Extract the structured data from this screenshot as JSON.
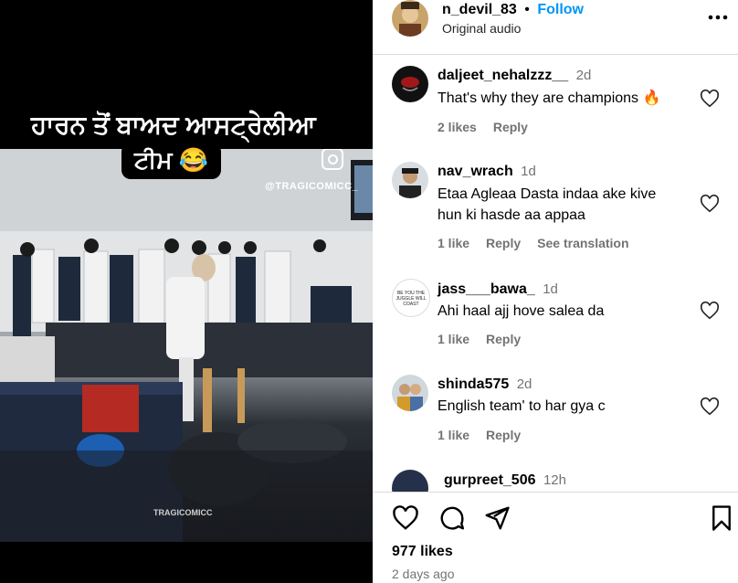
{
  "media": {
    "caption_line1": "ਹਾਰਨ ਤੋਂ ਬਾਅਦ ਆਸਟ੍ਰੇਲੀਆ",
    "caption_line2": "ਟੀਮ 😂",
    "watermark_top": "@TRAGICOMICC_",
    "watermark_bottom": "TRAGICOMICC"
  },
  "header": {
    "username": "n_devil_83",
    "separator": "•",
    "follow_label": "Follow",
    "audio": "Original audio",
    "more_icon": "more-horizontal-icon"
  },
  "comments": [
    {
      "username": "daljeet_nehalzzz__",
      "time": "2d",
      "text": "That's why they are champions 🔥",
      "likes": "2 likes",
      "reply": "Reply",
      "translate": ""
    },
    {
      "username": "nav_wrach",
      "time": "1d",
      "text": "Etaa Agleaa Dasta indaa ake kive hun ki hasde aa appaa",
      "likes": "1 like",
      "reply": "Reply",
      "translate": "See translation"
    },
    {
      "username": "jass___bawa_",
      "time": "1d",
      "text": "Ahi haal ajj hove salea da",
      "likes": "1 like",
      "reply": "Reply",
      "translate": ""
    },
    {
      "username": "shinda575",
      "time": "2d",
      "text": "English team' to har gya c",
      "likes": "1 like",
      "reply": "Reply",
      "translate": ""
    },
    {
      "username": "gurpreet_506",
      "time": "12h"
    }
  ],
  "avatar_text": "BE YOU THE JUGGLE WILL COAST",
  "actions": {
    "like_icon": "heart-icon",
    "comment_icon": "comment-icon",
    "share_icon": "share-icon",
    "save_icon": "bookmark-icon"
  },
  "footer": {
    "likes": "977 likes",
    "date": "2 days ago"
  },
  "colors": {
    "follow": "#0095f6",
    "meta": "#737373",
    "divider": "#dbdbdb"
  }
}
